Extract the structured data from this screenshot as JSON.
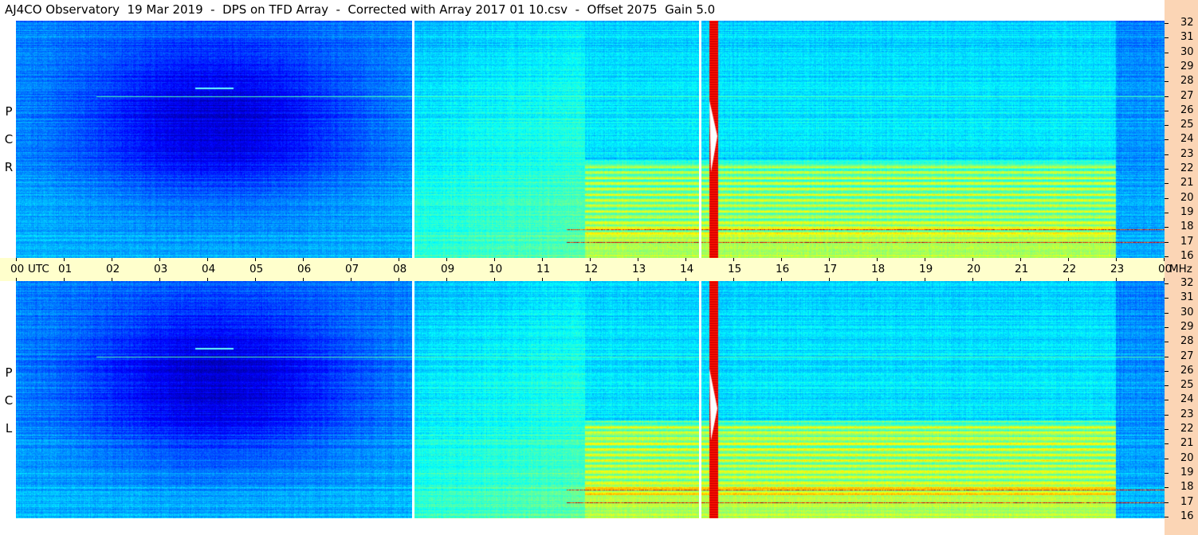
{
  "header": {
    "title": "AJ4CO Observatory  19 Mar 2019  -  DPS on TFD Array  -  Corrected with Array 2017 01 10.csv  -  Offset 2075  Gain 5.0"
  },
  "time_axis": {
    "labels": [
      "00",
      "UTC",
      "01",
      "02",
      "03",
      "04",
      "05",
      "06",
      "07",
      "08",
      "09",
      "10",
      "11",
      "12",
      "13",
      "14",
      "15",
      "16",
      "17",
      "18",
      "19",
      "20",
      "21",
      "22",
      "23",
      "00",
      "MHz"
    ]
  },
  "freq_axis": {
    "labels": [
      "32",
      "31",
      "30",
      "29",
      "28",
      "27",
      "26",
      "25",
      "24",
      "23",
      "22",
      "21",
      "20",
      "19",
      "18",
      "17",
      "16"
    ]
  },
  "panels": {
    "rcp_letters": [
      "R",
      "C",
      "P"
    ],
    "lcp_letters": [
      "L",
      "C",
      "P"
    ]
  },
  "colors": {
    "background_dark": "#000820",
    "band_blue": "#1a4fd8",
    "bright_cyan": "#33ddff",
    "axis_strip": "#ffffcc",
    "right_strip": "#fbd5b5"
  }
}
